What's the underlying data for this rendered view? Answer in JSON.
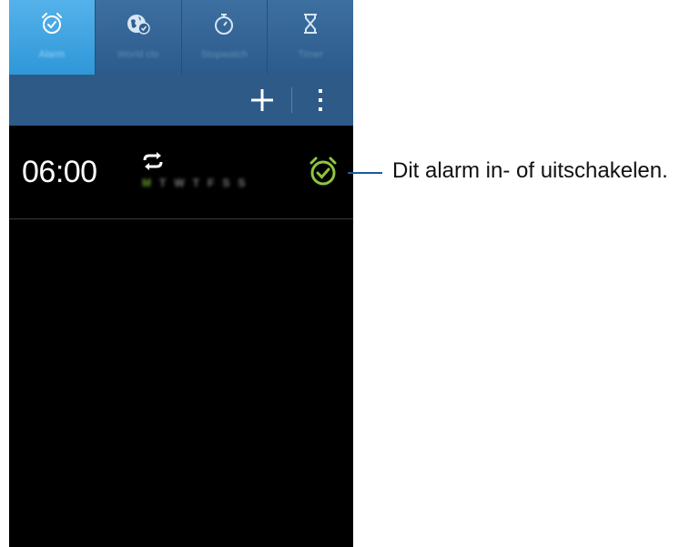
{
  "tabs": [
    {
      "label": "Alarm",
      "icon": "alarm-clock-icon",
      "active": true
    },
    {
      "label": "World clo",
      "icon": "world-clock-icon",
      "active": false
    },
    {
      "label": "Stopwatch",
      "icon": "stopwatch-icon",
      "active": false
    },
    {
      "label": "Timer",
      "icon": "hourglass-icon",
      "active": false
    }
  ],
  "actionbar": {
    "add_icon": "plus-icon",
    "more_icon": "more-vertical-icon"
  },
  "alarm": {
    "time": "06:00",
    "repeat_icon": "repeat-icon",
    "days": [
      "M",
      "T",
      "W",
      "T",
      "F",
      "S",
      "S"
    ],
    "enabled": true,
    "toggle_icon": "alarm-clock-icon"
  },
  "callout": {
    "text": "Dit alarm in- of uitschakelen."
  },
  "colors": {
    "active_tab": "#3aa1e0",
    "tabbar": "#2f5e8f",
    "alarm_on": "#8dc63f",
    "background": "#000000"
  }
}
